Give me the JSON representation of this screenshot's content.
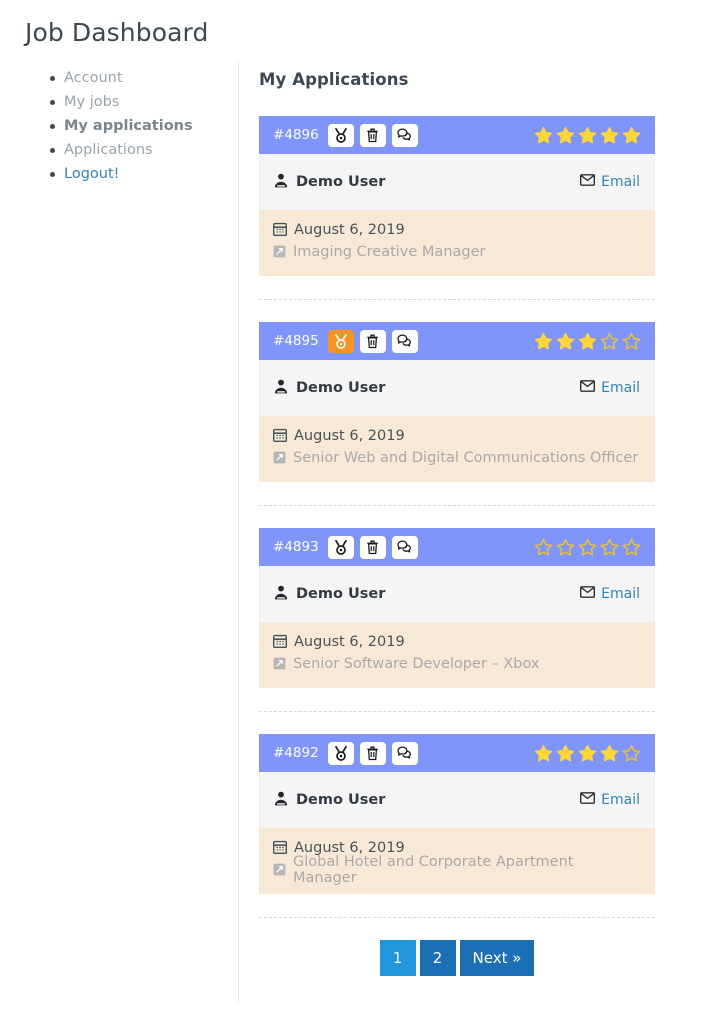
{
  "page": {
    "title": "Job Dashboard"
  },
  "sidebar": {
    "items": [
      {
        "label": "Account",
        "state": "normal"
      },
      {
        "label": "My jobs",
        "state": "normal"
      },
      {
        "label": "My applications",
        "state": "active"
      },
      {
        "label": "Applications",
        "state": "normal"
      },
      {
        "label": "Logout!",
        "state": "logout"
      }
    ]
  },
  "main": {
    "heading": "My Applications",
    "email_label": "Email",
    "user_icon": "user-tie-icon",
    "calendar_icon": "calendar-icon",
    "job_icon": "pen-square-icon",
    "envelope_icon": "envelope-icon",
    "actions": [
      {
        "name": "shortlist-icon",
        "title": "Shortlist"
      },
      {
        "name": "trash-icon",
        "title": "Delete"
      },
      {
        "name": "comments-icon",
        "title": "Comments"
      }
    ],
    "applications": [
      {
        "id": "#4896",
        "user": "Demo User",
        "date": "August 6, 2019",
        "job": "Imaging Creative Manager",
        "rating": 5,
        "max_rating": 5,
        "shortlisted": false
      },
      {
        "id": "#4895",
        "user": "Demo User",
        "date": "August 6, 2019",
        "job": "Senior Web and Digital Communications Officer",
        "rating": 3,
        "max_rating": 5,
        "shortlisted": true
      },
      {
        "id": "#4893",
        "user": "Demo User",
        "date": "August 6, 2019",
        "job": "Senior Software Developer – Xbox",
        "rating": 0,
        "max_rating": 5,
        "shortlisted": false
      },
      {
        "id": "#4892",
        "user": "Demo User",
        "date": "August 6, 2019",
        "job": "Global Hotel and Corporate Apartment Manager",
        "rating": 4,
        "max_rating": 5,
        "shortlisted": false
      }
    ]
  },
  "pagination": {
    "items": [
      {
        "label": "1",
        "current": true
      },
      {
        "label": "2",
        "current": false
      },
      {
        "label": "Next »",
        "current": false
      }
    ]
  },
  "colors": {
    "card_header": "#7f95fb",
    "card_meta": "#f8e9d7",
    "card_user": "#f5f5f5",
    "star_filled": "#ffd633",
    "star_empty_stroke": "#f5c518",
    "shortlist_active": "#f79420",
    "link": "#3284bd",
    "page_current": "#2196dd",
    "page_default": "#1b6fb5"
  }
}
